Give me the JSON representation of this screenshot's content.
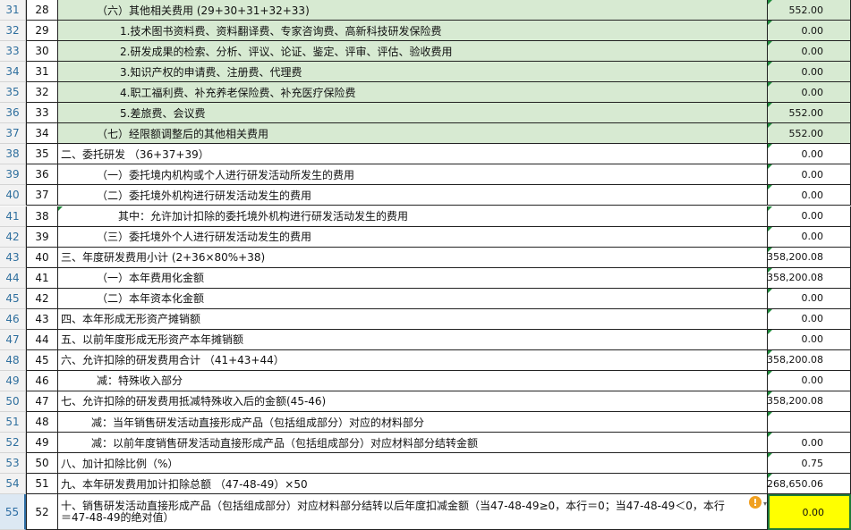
{
  "rows": [
    {
      "row": "31",
      "seq": "28",
      "text": "（六）其他相关费用 (29+30+31+32+33)",
      "value": "552.00",
      "indent": 40,
      "green": true,
      "vtri": true
    },
    {
      "row": "32",
      "seq": "29",
      "text": "1.技术图书资料费、资料翻译费、专家咨询费、高新科技研发保险费",
      "value": "0.00",
      "indent": 66,
      "green": true,
      "vtri": true
    },
    {
      "row": "33",
      "seq": "30",
      "text": "2.研发成果的检索、分析、评议、论证、鉴定、评审、评估、验收费用",
      "value": "0.00",
      "indent": 66,
      "green": true,
      "vtri": true
    },
    {
      "row": "34",
      "seq": "31",
      "text": "3.知识产权的申请费、注册费、代理费",
      "value": "0.00",
      "indent": 66,
      "green": true,
      "vtri": true
    },
    {
      "row": "35",
      "seq": "32",
      "text": "4.职工福利费、补充养老保险费、补充医疗保险费",
      "value": "0.00",
      "indent": 66,
      "green": true,
      "vtri": true
    },
    {
      "row": "36",
      "seq": "33",
      "text": "5.差旅费、会议费",
      "value": "552.00",
      "indent": 66,
      "green": true,
      "vtri": true
    },
    {
      "row": "37",
      "seq": "34",
      "text": "（七）经限额调整后的其他相关费用",
      "value": "552.00",
      "indent": 40,
      "green": true,
      "vtri": true
    },
    {
      "row": "38",
      "seq": "35",
      "text": "二、委托研发 （36+37+39）",
      "value": "0.00",
      "indent": 0,
      "vtri": true
    },
    {
      "row": "39",
      "seq": "36",
      "text": "（一）委托境内机构或个人进行研发活动所发生的费用",
      "value": "0.00",
      "indent": 40,
      "vtri": true
    },
    {
      "row": "40",
      "seq": "37",
      "text": "（二）委托境外机构进行研发活动发生的费用",
      "value": "0.00",
      "indent": 40,
      "vtri": true
    },
    {
      "row": "41",
      "seq": "38",
      "text": "其中：允许加计扣除的委托境外机构进行研发活动发生的费用",
      "value": "0.00",
      "indent": 64,
      "dtri": true,
      "vtri": true
    },
    {
      "row": "42",
      "seq": "39",
      "text": "（三）委托境外个人进行研发活动发生的费用",
      "value": "0.00",
      "indent": 40,
      "vtri": true
    },
    {
      "row": "43",
      "seq": "40",
      "text": "三、年度研发费用小计 (2+36×80%+38)",
      "value": "358,200.08",
      "indent": 0,
      "vtri": true
    },
    {
      "row": "44",
      "seq": "41",
      "text": "（一）本年费用化金额",
      "value": "358,200.08",
      "indent": 40,
      "vtri": true
    },
    {
      "row": "45",
      "seq": "42",
      "text": "（二）本年资本化金额",
      "value": "0.00",
      "indent": 40,
      "vtri": true
    },
    {
      "row": "46",
      "seq": "43",
      "text": "四、本年形成无形资产摊销额",
      "value": "0.00",
      "indent": 0,
      "vtri": true
    },
    {
      "row": "47",
      "seq": "44",
      "text": "五、以前年度形成无形资产本年摊销额",
      "value": "0.00",
      "indent": 0,
      "vtri": true
    },
    {
      "row": "48",
      "seq": "45",
      "text": "六、允许扣除的研发费用合计 （41+43+44）",
      "value": "358,200.08",
      "indent": 0,
      "vtri": true
    },
    {
      "row": "49",
      "seq": "46",
      "text": "减：特殊收入部分",
      "value": "0.00",
      "indent": 40,
      "vtri": true
    },
    {
      "row": "50",
      "seq": "47",
      "text": "七、允许扣除的研发费用抵减特殊收入后的金额(45-46)",
      "value": "358,200.08",
      "indent": 0,
      "vtri": true
    },
    {
      "row": "51",
      "seq": "48",
      "text": "减：当年销售研发活动直接形成产品（包括组成部分）对应的材料部分",
      "value": "",
      "indent": 34,
      "vtri": true
    },
    {
      "row": "52",
      "seq": "49",
      "text": "减：以前年度销售研发活动直接形成产品（包括组成部分）对应材料部分结转金额",
      "value": "0.00",
      "indent": 34,
      "vtri": true
    },
    {
      "row": "53",
      "seq": "50",
      "text": "八、加计扣除比例（%）",
      "value": "0.75",
      "indent": 0,
      "vtri": true
    },
    {
      "row": "54",
      "seq": "51",
      "text": "九、本年研发费用加计扣除总额 （47-48-49）×50",
      "value": "268,650.06",
      "indent": 0,
      "vtri": true
    },
    {
      "row": "55",
      "seq": "52",
      "text": "十、销售研发活动直接形成产品（包括组成部分）对应材料部分结转以后年度扣减金额（当47-48-49≥0，本行＝0；当47-48-49＜0，本行＝47-48-49的绝对值）",
      "value": "0.00",
      "indent": 0,
      "selected": true,
      "wrap": true,
      "warn": true
    }
  ],
  "warning_icon": "!",
  "colors": {
    "green_fill": "#d7ead2",
    "selected_fill": "#ffff00",
    "selected_border": "#1e7a3a"
  }
}
